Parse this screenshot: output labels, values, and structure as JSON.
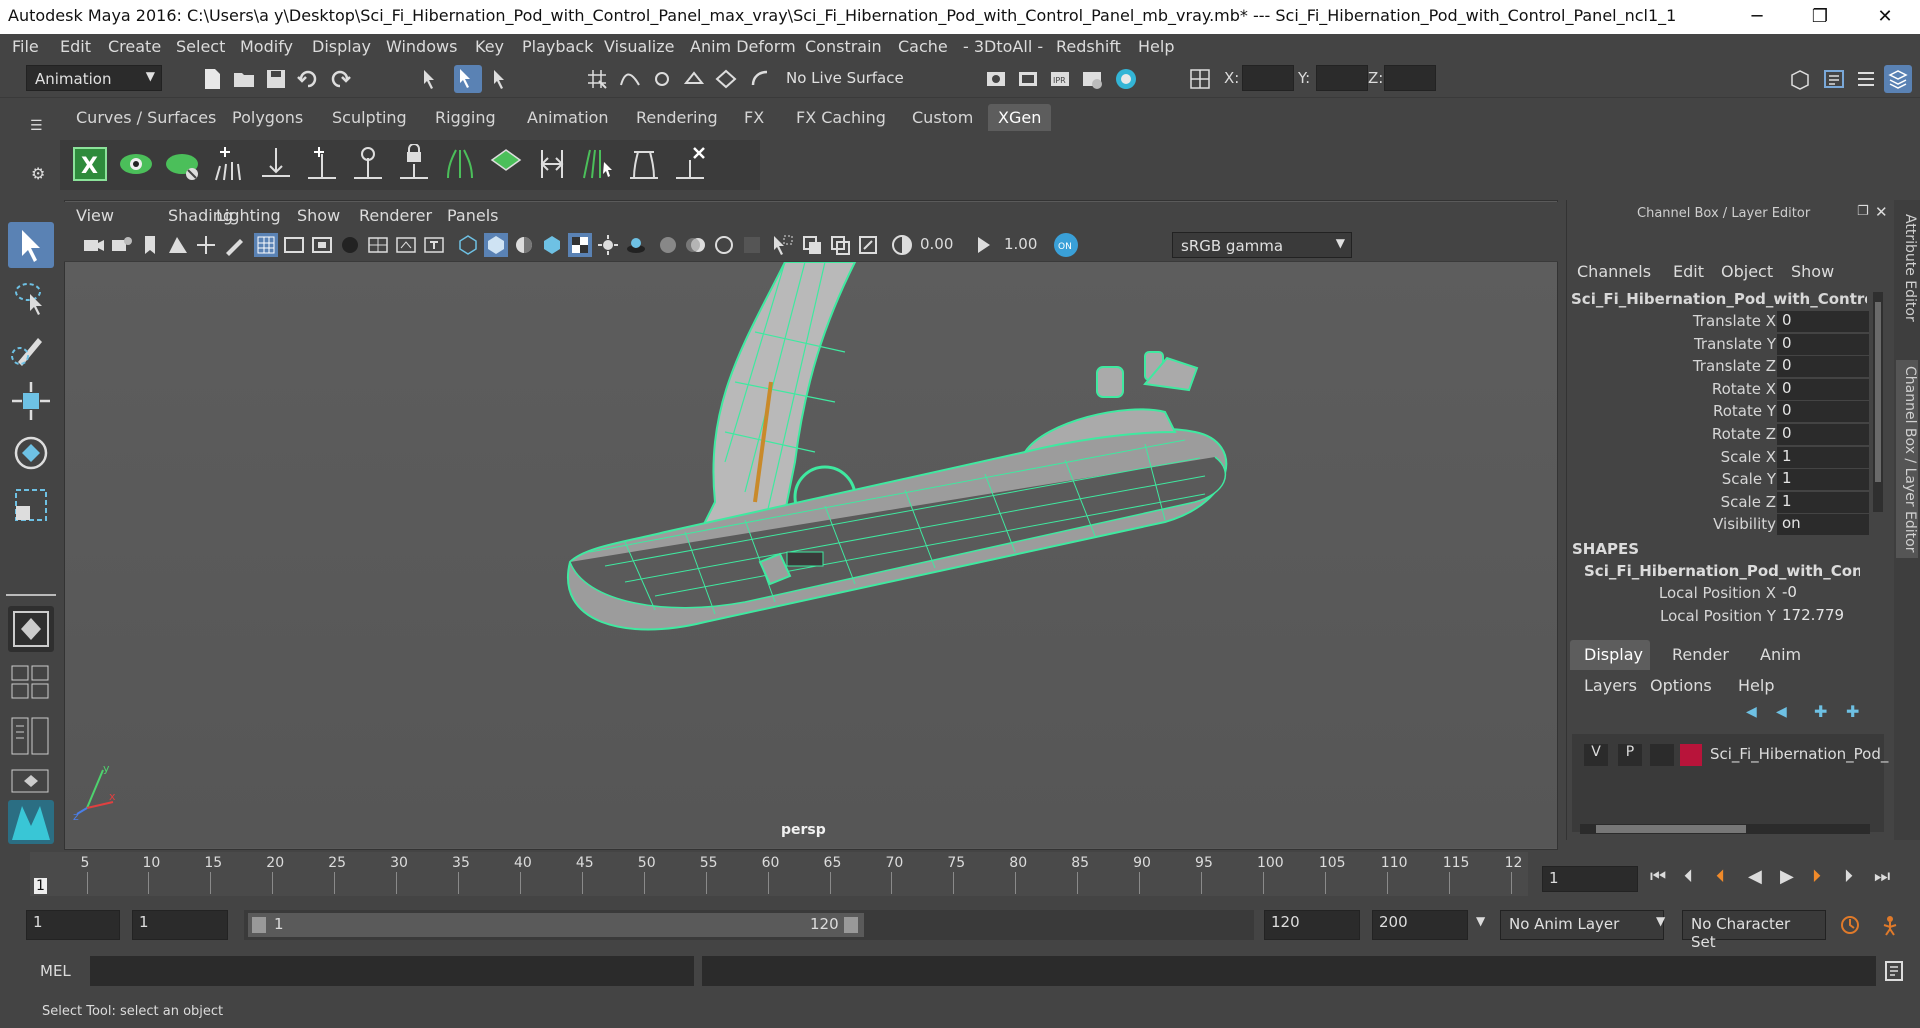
{
  "titlebar": {
    "title": "Autodesk Maya 2016: C:\\Users\\a y\\Desktop\\Sci_Fi_Hibernation_Pod_with_Control_Panel_max_vray\\Sci_Fi_Hibernation_Pod_with_Control_Panel_mb_vray.mb*   ---   Sci_Fi_Hibernation_Pod_with_Control_Panel_ncl1_1",
    "minimize": "─",
    "maximize": "❐",
    "close": "✕"
  },
  "menubar": [
    "File",
    "Edit",
    "Create",
    "Select",
    "Modify",
    "Display",
    "Windows",
    "Key",
    "Playback",
    "Visualize",
    "Anim Deform",
    "Constrain",
    "Cache",
    "- 3DtoAll -",
    "Redshift",
    "Help"
  ],
  "statusline": {
    "mode": "Animation",
    "live_surface": "No Live Surface",
    "x_label": "X:",
    "y_label": "Y:",
    "z_label": "Z:"
  },
  "shelf": {
    "tabs": [
      "Curves / Surfaces",
      "Polygons",
      "Sculpting",
      "Rigging",
      "Animation",
      "Rendering",
      "FX",
      "FX Caching",
      "Custom",
      "XGen"
    ],
    "active_tab": "XGen"
  },
  "viewport": {
    "menu": [
      "View",
      "Shading",
      "Lighting",
      "Show",
      "Renderer",
      "Panels"
    ],
    "exposure": "0.00",
    "gamma": "1.00",
    "color_space": "sRGB gamma",
    "camera_label": "persp"
  },
  "channelbox": {
    "title": "Channel Box / Layer Editor",
    "menu": [
      "Channels",
      "Edit",
      "Object",
      "Show"
    ],
    "object_name": "Sci_Fi_Hibernation_Pod_with_Control_...",
    "channels": [
      {
        "label": "Translate X",
        "value": "0"
      },
      {
        "label": "Translate Y",
        "value": "0"
      },
      {
        "label": "Translate Z",
        "value": "0"
      },
      {
        "label": "Rotate X",
        "value": "0"
      },
      {
        "label": "Rotate Y",
        "value": "0"
      },
      {
        "label": "Rotate Z",
        "value": "0"
      },
      {
        "label": "Scale X",
        "value": "1"
      },
      {
        "label": "Scale Y",
        "value": "1"
      },
      {
        "label": "Scale Z",
        "value": "1"
      },
      {
        "label": "Visibility",
        "value": "on"
      }
    ],
    "shapes_header": "SHAPES",
    "shape_name": "Sci_Fi_Hibernation_Pod_with_Contr...",
    "shape_channels": [
      {
        "label": "Local Position X",
        "value": "-0"
      },
      {
        "label": "Local Position Y",
        "value": "172.779"
      }
    ],
    "layer_tabs": [
      "Display",
      "Render",
      "Anim"
    ],
    "layer_menu": [
      "Layers",
      "Options",
      "Help"
    ],
    "layer": {
      "v": "V",
      "p": "P",
      "name": "Sci_Fi_Hibernation_Pod_",
      "color": "#b8143a"
    },
    "side_tabs": [
      "Attribute Editor",
      "Channel Box / Layer Editor"
    ]
  },
  "timeline": {
    "ticks": [
      "5",
      "10",
      "15",
      "20",
      "25",
      "30",
      "35",
      "40",
      "45",
      "50",
      "55",
      "60",
      "65",
      "70",
      "75",
      "80",
      "85",
      "90",
      "95",
      "100",
      "105",
      "110",
      "115",
      "12"
    ],
    "current_frame_marker": "1",
    "current_frame": "1"
  },
  "range": {
    "start": "1",
    "playback_start": "1",
    "slider_start": "1",
    "slider_end": "120",
    "playback_end": "120",
    "end": "200",
    "anim_layer": "No Anim Layer",
    "character_set": "No Character Set"
  },
  "cmdline": {
    "label": "MEL"
  },
  "helpline": {
    "text": "Select Tool: select an object"
  },
  "colors": {
    "accent": "#5d5d5d",
    "wire": "#3fe9a0",
    "bg": "#444444"
  }
}
